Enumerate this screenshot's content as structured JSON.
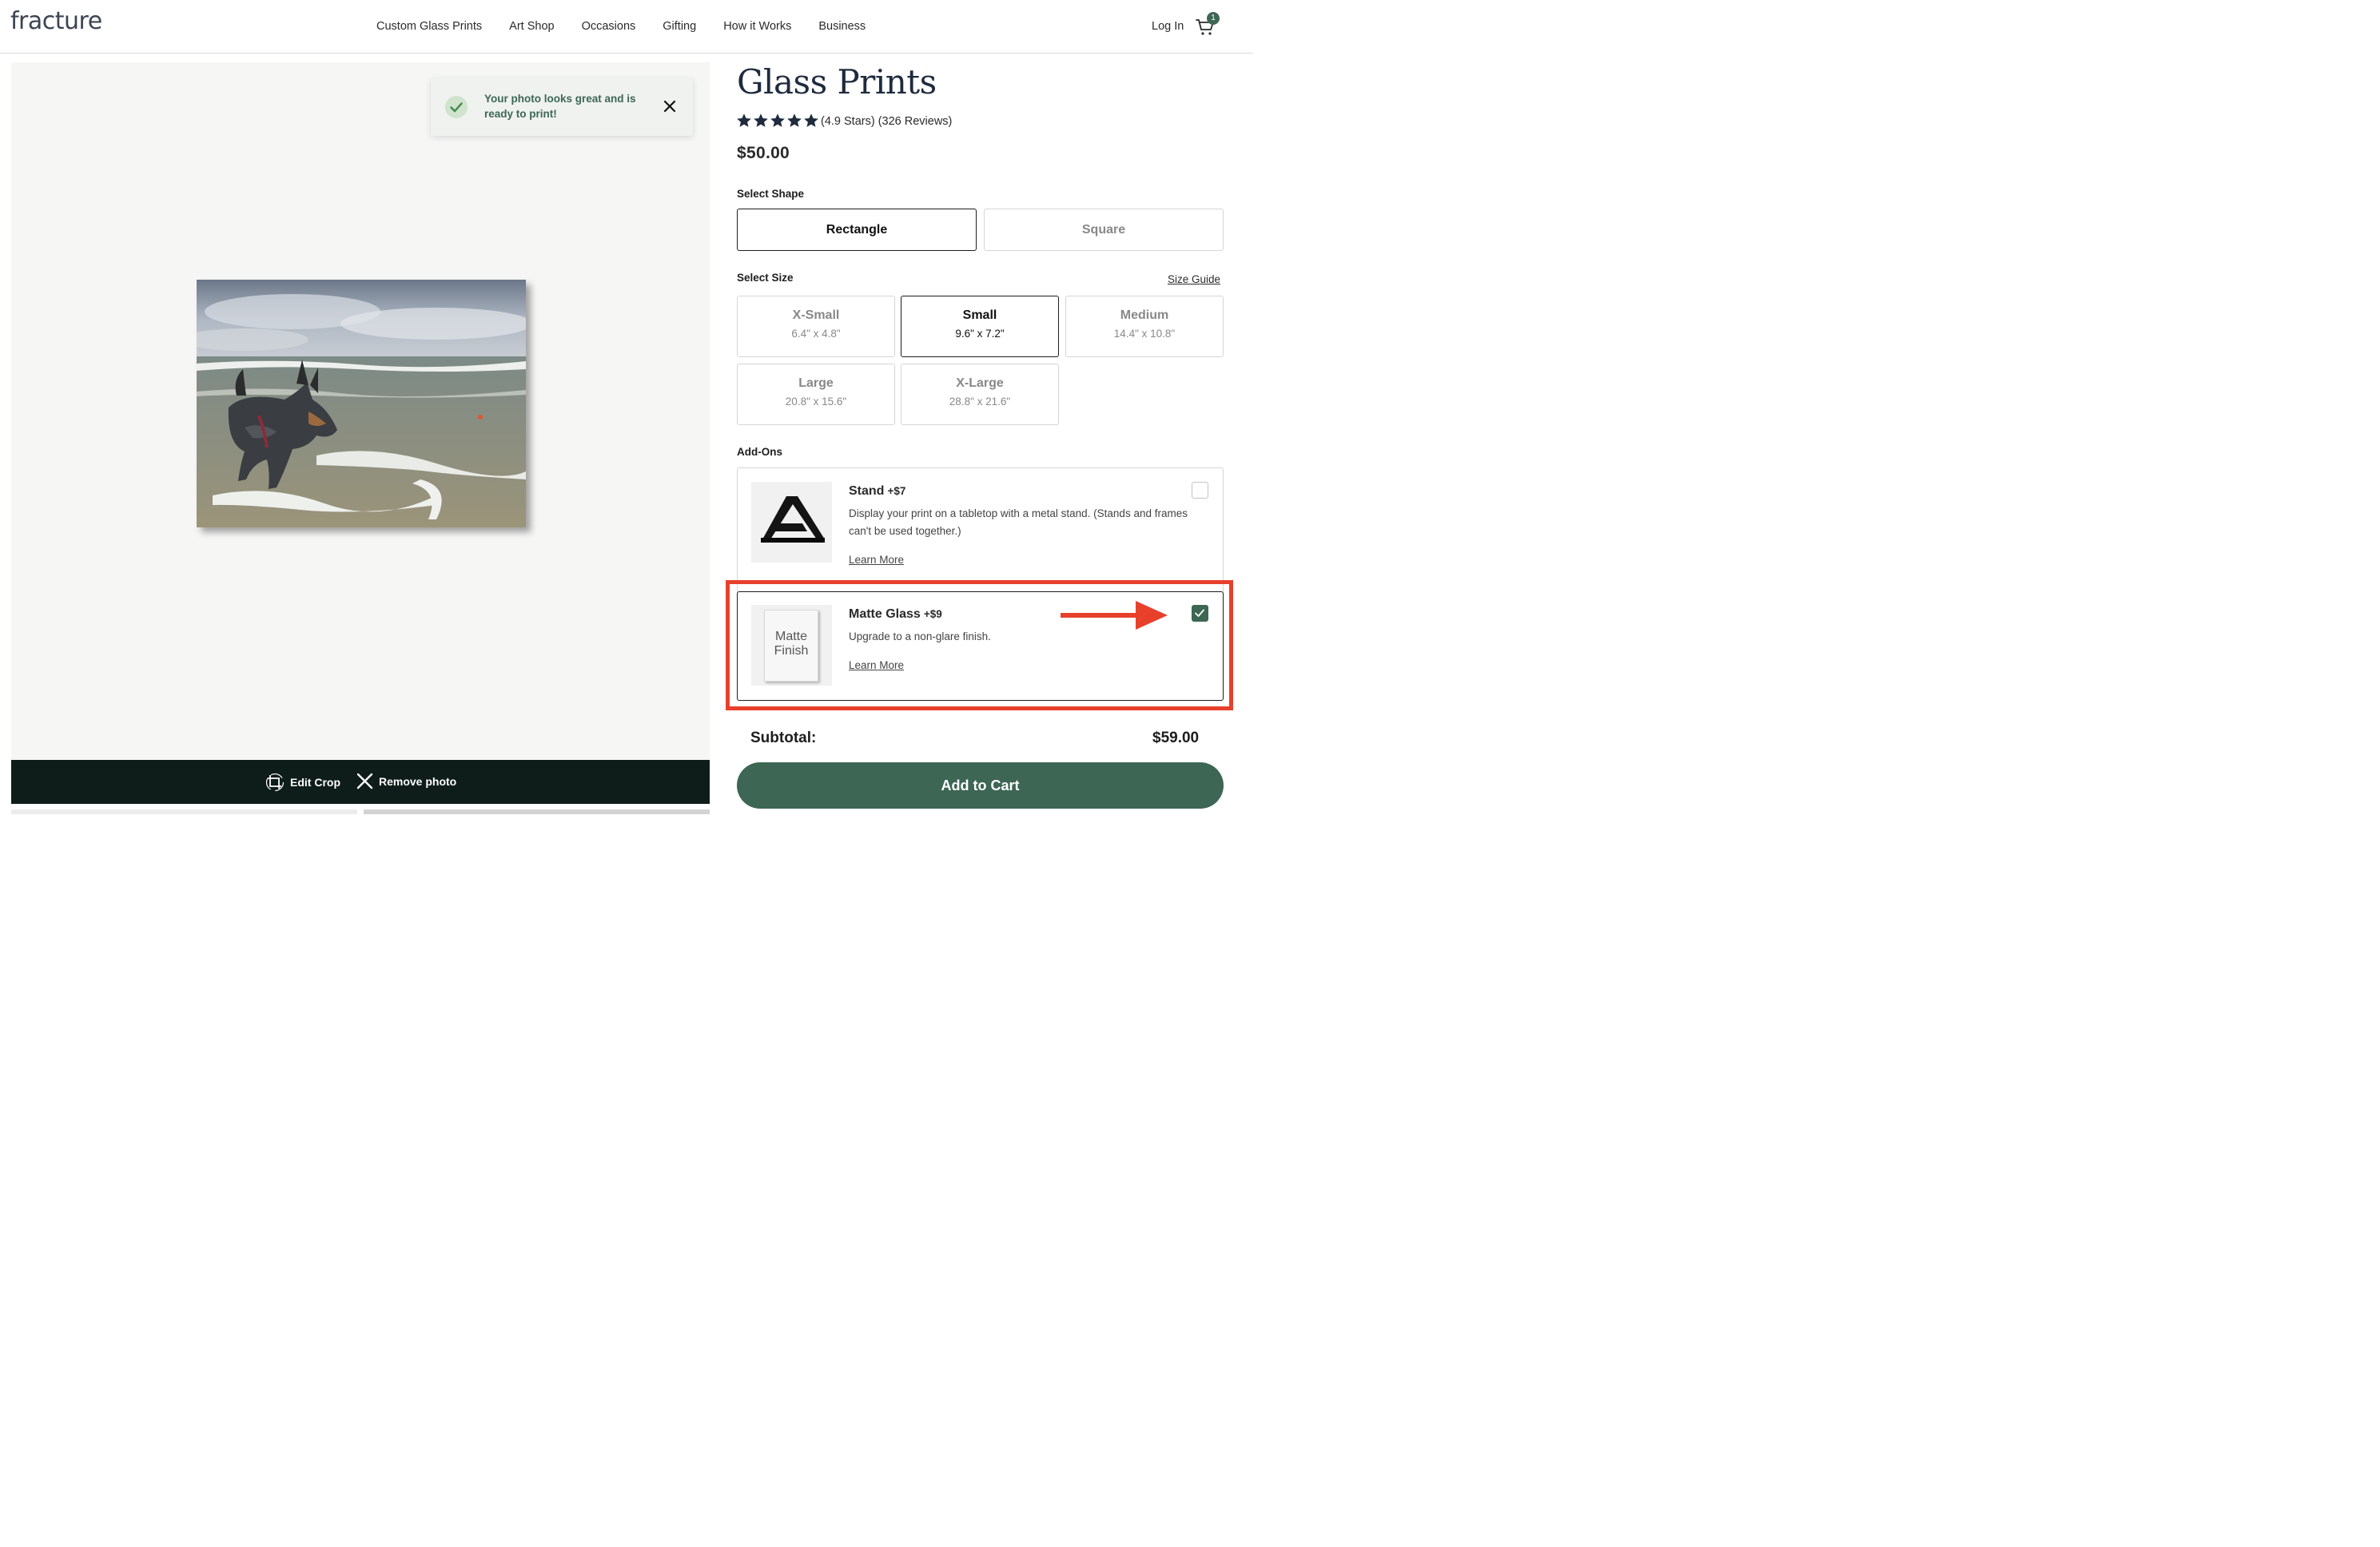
{
  "header": {
    "logo": "fracture",
    "nav": [
      "Custom Glass Prints",
      "Art Shop",
      "Occasions",
      "Gifting",
      "How it Works",
      "Business"
    ],
    "login": "Log In",
    "cart_count": "1"
  },
  "preview": {
    "toast_message": "Your photo looks great and is ready to print!",
    "edit_crop": "Edit Crop",
    "remove_photo": "Remove photo"
  },
  "product": {
    "title": "Glass Prints",
    "stars": 5,
    "rating_text": "(4.9 Stars) (326 Reviews)",
    "price": "$50.00"
  },
  "shape": {
    "label": "Select Shape",
    "options": [
      "Rectangle",
      "Square"
    ],
    "selected": "Rectangle"
  },
  "size": {
    "label": "Select Size",
    "guide": "Size Guide",
    "options": [
      {
        "name": "X-Small",
        "dim": "6.4\" x 4.8\""
      },
      {
        "name": "Small",
        "dim": "9.6\" x 7.2\""
      },
      {
        "name": "Medium",
        "dim": "14.4\" x 10.8\""
      },
      {
        "name": "Large",
        "dim": "20.8\" x 15.6\""
      },
      {
        "name": "X-Large",
        "dim": "28.8\" x 21.6\""
      }
    ],
    "selected": "Small"
  },
  "addons": {
    "label": "Add-Ons",
    "items": [
      {
        "name": "Stand",
        "price": "+$7",
        "desc": "Display your print on a tabletop with a metal stand. (Stands and frames can't be used together.)",
        "link": "Learn More",
        "checked": false
      },
      {
        "name": "Matte Glass",
        "price": "+$9",
        "desc": "Upgrade to a non-glare finish.",
        "link": "Learn More",
        "checked": true,
        "thumb_text": "Matte Finish"
      }
    ]
  },
  "summary": {
    "subtotal_label": "Subtotal:",
    "subtotal_value": "$59.00",
    "add_to_cart": "Add to Cart"
  },
  "colors": {
    "brand_green": "#3d6655",
    "annotation_red": "#e7412c",
    "title_navy": "#1f2b3e"
  }
}
